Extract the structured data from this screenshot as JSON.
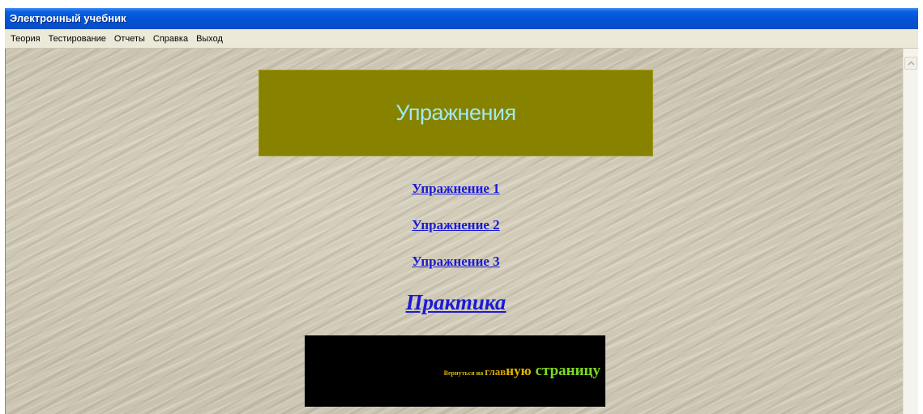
{
  "window": {
    "title": "Электронный учебник"
  },
  "menu": {
    "items": [
      "Теория",
      "Тестирование",
      "Отчеты",
      "Справка",
      "Выход"
    ]
  },
  "page": {
    "banner_title": "Упражнения",
    "exercises": [
      "Упражнение 1",
      "Упражнение 2",
      "Упражнение 3"
    ],
    "practice": "Практика",
    "back_link": {
      "part1": "Вернуться",
      "part2": "на",
      "part3": "глав",
      "part4": "ную",
      "part5": "страницу"
    }
  },
  "colors": {
    "titlebar": "#0454d6",
    "menubar": "#ece9d8",
    "banner": "#878200",
    "banner_text": "#9fe9ef",
    "link": "#1a1ad6",
    "back_box": "#000000"
  },
  "icons": {
    "scroll_up": "scroll-up-arrow-icon"
  }
}
